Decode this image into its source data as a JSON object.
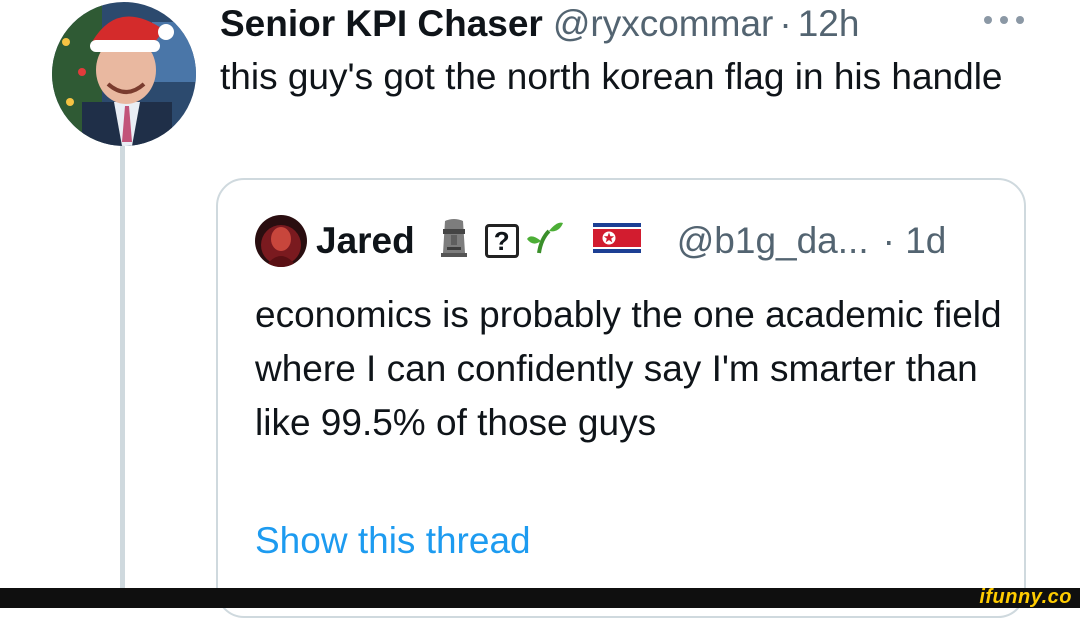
{
  "tweet": {
    "author_name": "Senior KPI Chaser",
    "author_handle": "@ryxcommar",
    "separator": "·",
    "time": "12h",
    "text": "this guy's got the north korean flag in his handle"
  },
  "quote": {
    "author_name": "Jared",
    "question_glyph": "?",
    "author_handle": "@b1g_da...",
    "time": "· 1d",
    "text": "economics is probably the one academic field where I can confidently say I'm smarter than like 99.5% of those guys",
    "show_thread_label": "Show this thread"
  },
  "watermark": "ifunny.co",
  "icons": {
    "more": "more-options-icon",
    "moai": "moai-emoji-icon",
    "question": "question-box-icon",
    "sprout": "seedling-emoji-icon",
    "flag": "north-korea-flag-icon"
  },
  "colors": {
    "link": "#1d9bf0",
    "secondary_text": "#536471",
    "border": "#cfd9de"
  }
}
